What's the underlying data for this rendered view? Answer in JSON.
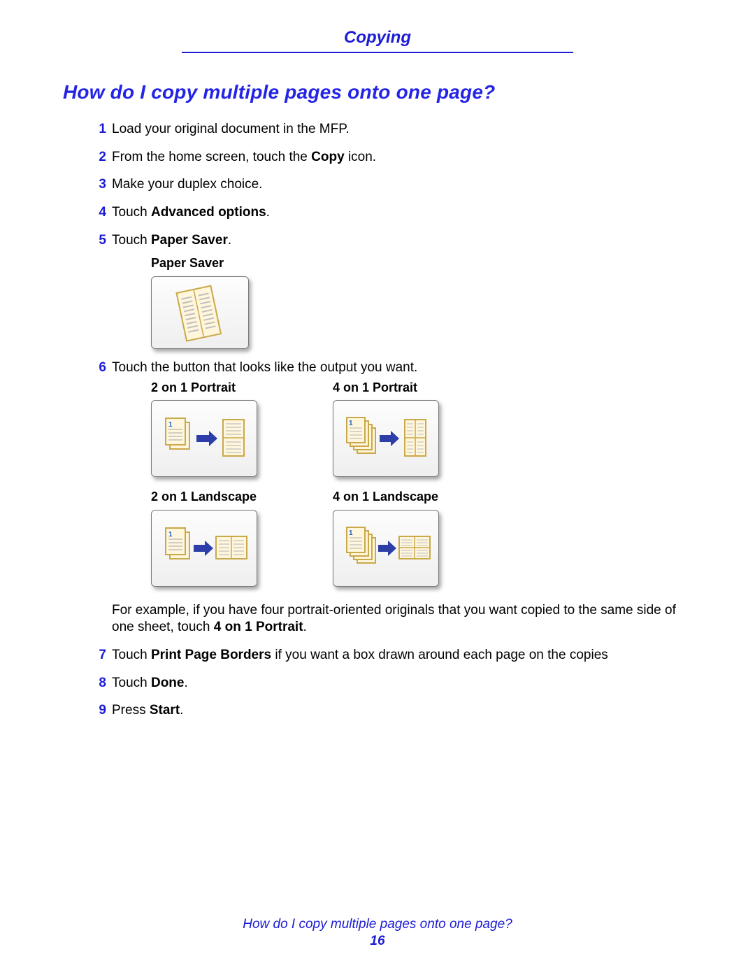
{
  "header": {
    "section": "Copying"
  },
  "title": "How do I copy multiple pages onto one page?",
  "steps": {
    "s1": {
      "text": "Load your original document in the MFP."
    },
    "s2": {
      "pre": "From the home screen, touch the ",
      "bold": "Copy",
      "post": " icon."
    },
    "s3": {
      "text": "Make your duplex choice."
    },
    "s4": {
      "pre": "Touch ",
      "bold": "Advanced options",
      "post": "."
    },
    "s5": {
      "pre": "Touch ",
      "bold": "Paper Saver",
      "post": ".",
      "sublabel": "Paper Saver"
    },
    "s6": {
      "text": "Touch the button that looks like the output you want.",
      "options": {
        "o1": "2 on 1 Portrait",
        "o2": "4 on 1 Portrait",
        "o3": "2 on 1 Landscape",
        "o4": "4 on 1 Landscape"
      },
      "example_pre": "For example, if you have four portrait-oriented originals that you want copied to the same side of one sheet, touch ",
      "example_bold": "4 on 1 Portrait",
      "example_post": "."
    },
    "s7": {
      "pre": "Touch ",
      "bold": "Print Page Borders",
      "post": " if you want a box drawn around each page on the copies"
    },
    "s8": {
      "pre": "Touch ",
      "bold": "Done",
      "post": "."
    },
    "s9": {
      "pre": "Press ",
      "bold": "Start",
      "post": "."
    }
  },
  "footer": {
    "question": "How do I copy multiple pages onto one page?",
    "page": "16"
  }
}
